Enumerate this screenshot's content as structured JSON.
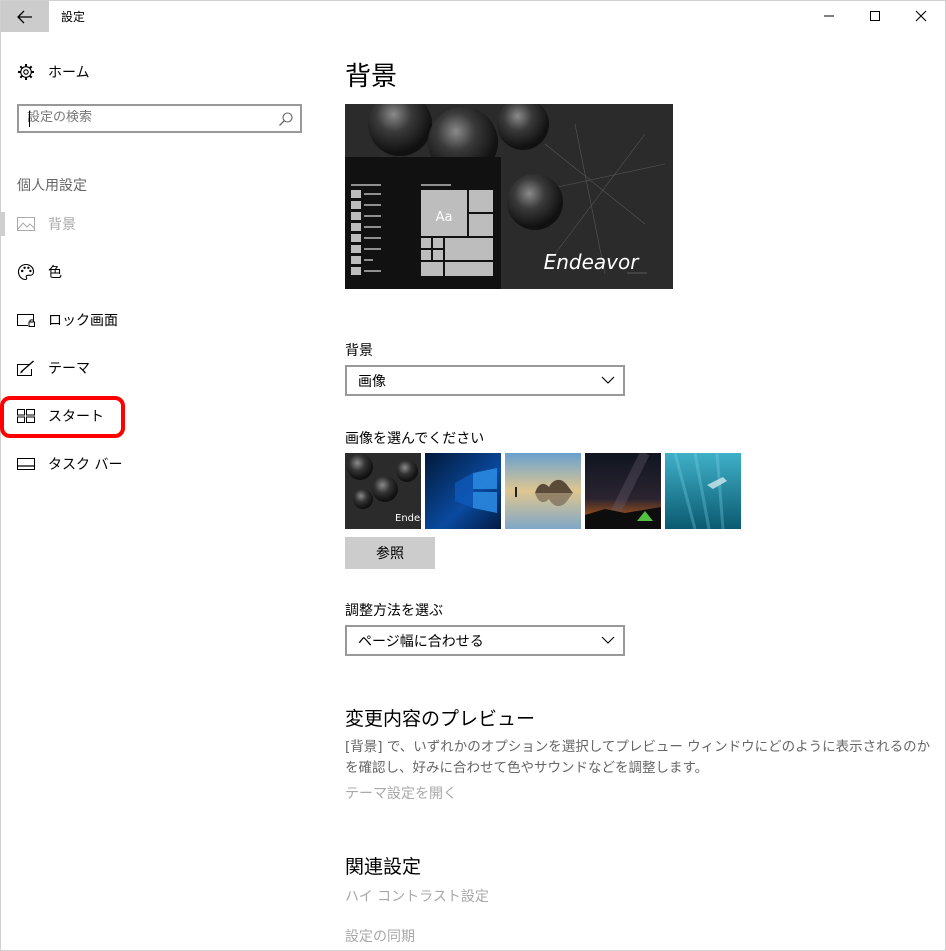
{
  "window": {
    "title": "設定"
  },
  "sidebar": {
    "home_label": "ホーム",
    "search_placeholder": "設定の検索",
    "section_title": "個人用設定",
    "items": [
      {
        "label": "背景",
        "icon": "image-icon",
        "active": true
      },
      {
        "label": "色",
        "icon": "palette-icon"
      },
      {
        "label": "ロック画面",
        "icon": "lock-screen-icon"
      },
      {
        "label": "テーマ",
        "icon": "theme-brush-icon"
      },
      {
        "label": "スタート",
        "icon": "start-menu-icon",
        "highlighted": true
      },
      {
        "label": "タスク バー",
        "icon": "taskbar-icon"
      }
    ]
  },
  "main": {
    "title": "背景",
    "preview": {
      "sample_text": "Aa",
      "wallpaper_text": "Endeavor"
    },
    "background": {
      "label": "背景",
      "value": "画像"
    },
    "choose": {
      "label": "画像を選んでください",
      "thumbs": [
        {
          "name": "endeavor",
          "caption": "Endea"
        },
        {
          "name": "windows10"
        },
        {
          "name": "beach-rocks"
        },
        {
          "name": "night-sky-tent"
        },
        {
          "name": "underwater-diver"
        }
      ]
    },
    "browse_label": "参照",
    "fit": {
      "label": "調整方法を選ぶ",
      "value": "ページ幅に合わせる"
    },
    "preview_section": {
      "title": "変更内容のプレビュー",
      "description": "[背景] で、いずれかのオプションを選択してプレビュー ウィンドウにどのように表示されるのかを確認し、好みに合わせて色やサウンドなどを調整します。",
      "link": "テーマ設定を開く"
    },
    "related": {
      "title": "関連設定",
      "links": [
        "ハイ コントラスト設定",
        "設定の同期"
      ]
    }
  },
  "colors": {
    "highlight": "#ff0000",
    "button_gray": "#cccccc",
    "muted_text": "#a8a8a8"
  }
}
